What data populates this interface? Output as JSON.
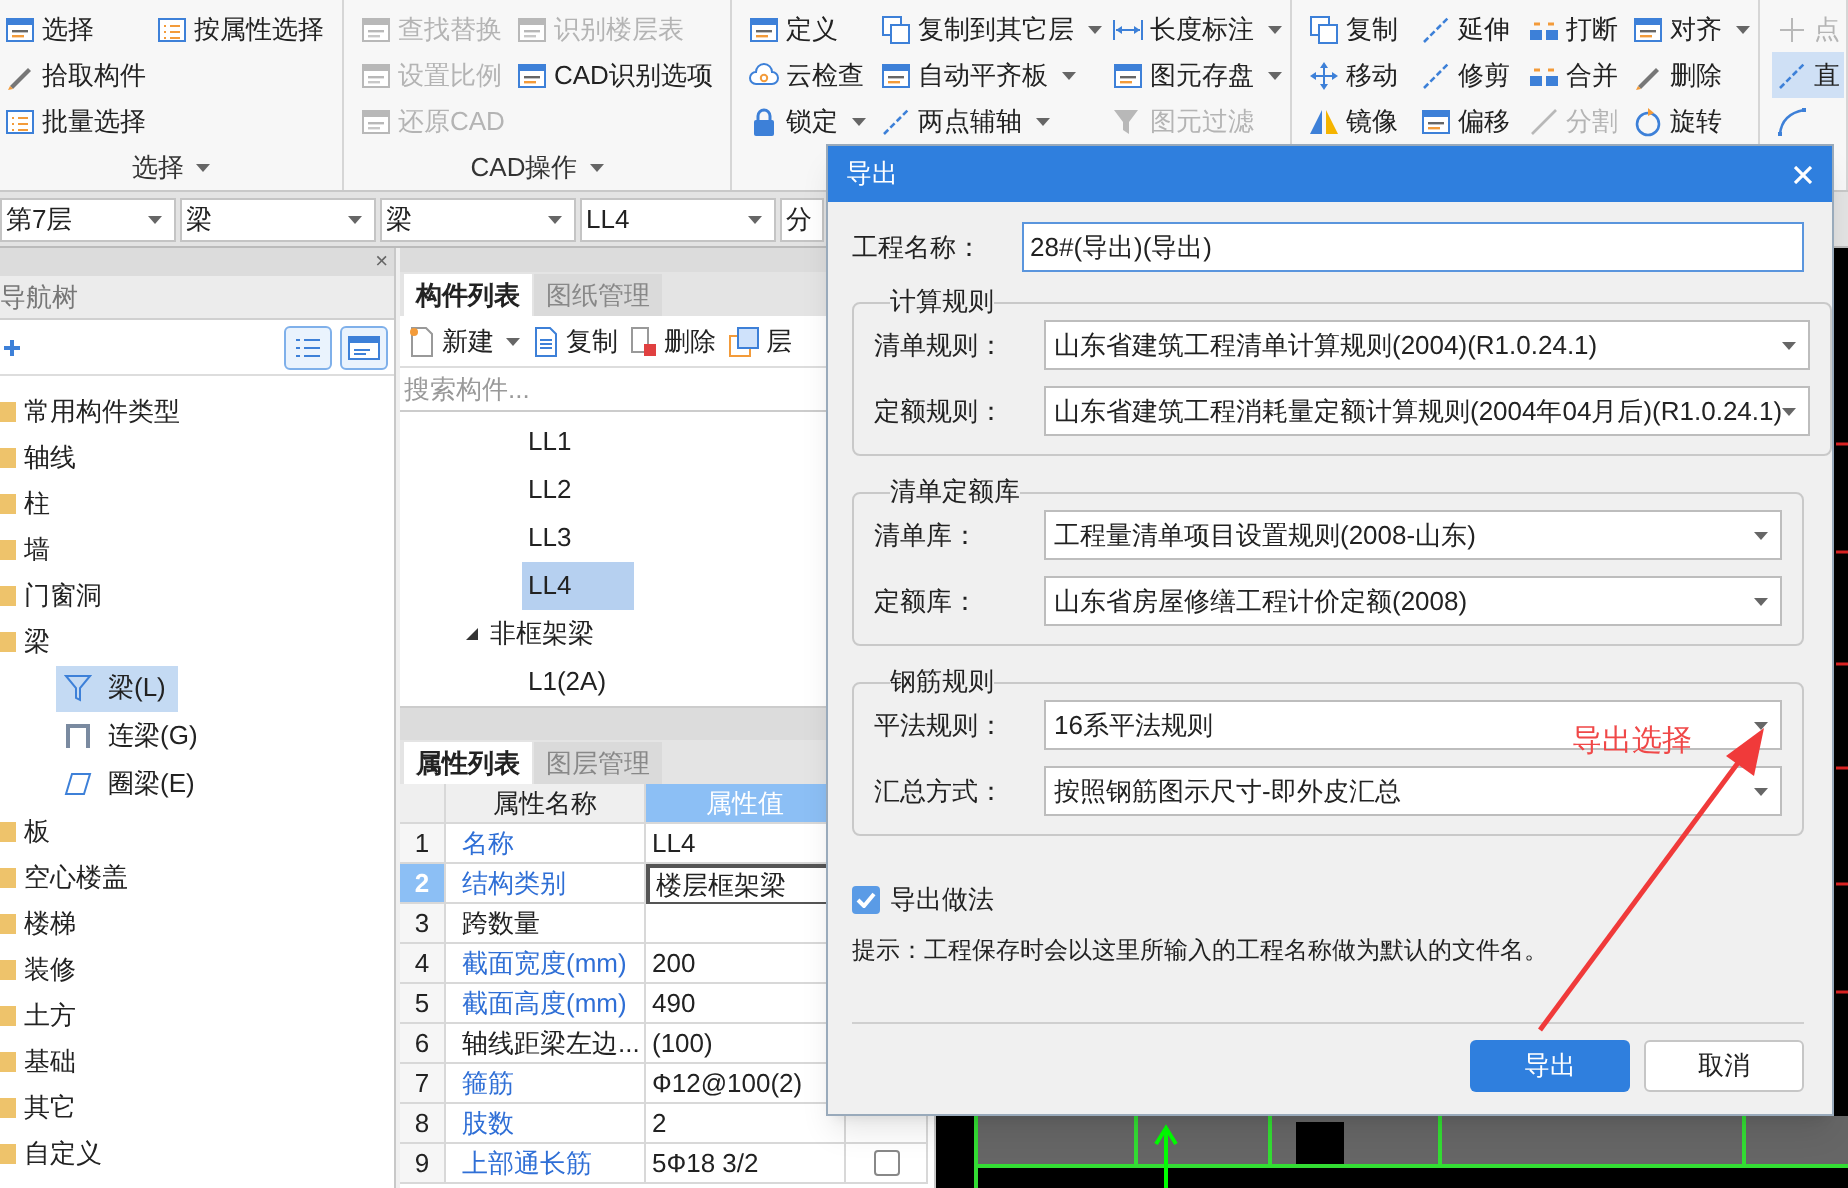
{
  "ribbon": {
    "groups": [
      {
        "label": "选择",
        "columns": [
          [
            {
              "label": "选择",
              "disabled": false,
              "dropdown": false,
              "selected": false
            },
            {
              "label": "拾取构件",
              "disabled": false,
              "dropdown": false,
              "selected": false
            },
            {
              "label": "批量选择",
              "disabled": false,
              "dropdown": false,
              "selected": false
            }
          ],
          [
            {
              "label": "按属性选择",
              "disabled": false,
              "dropdown": false,
              "selected": false
            }
          ]
        ]
      },
      {
        "label": "CAD操作",
        "columns": [
          [
            {
              "label": "查找替换",
              "disabled": true,
              "dropdown": false,
              "selected": false
            },
            {
              "label": "设置比例",
              "disabled": true,
              "dropdown": false,
              "selected": false
            },
            {
              "label": "还原CAD",
              "disabled": true,
              "dropdown": false,
              "selected": false
            }
          ],
          [
            {
              "label": "识别楼层表",
              "disabled": true,
              "dropdown": false,
              "selected": false
            },
            {
              "label": "CAD识别选项",
              "disabled": false,
              "dropdown": false,
              "selected": false
            }
          ]
        ]
      },
      {
        "columns": [
          [
            {
              "label": "定义",
              "disabled": false,
              "dropdown": false,
              "selected": false
            },
            {
              "label": "云检查",
              "disabled": false,
              "dropdown": false,
              "selected": false
            },
            {
              "label": "锁定",
              "disabled": false,
              "dropdown": true,
              "selected": false
            }
          ],
          [
            {
              "label": "复制到其它层",
              "disabled": false,
              "dropdown": true,
              "selected": false
            },
            {
              "label": "自动平齐板",
              "disabled": false,
              "dropdown": true,
              "selected": false
            },
            {
              "label": "两点辅轴",
              "disabled": false,
              "dropdown": true,
              "selected": false
            }
          ],
          [
            {
              "label": "长度标注",
              "disabled": false,
              "dropdown": true,
              "selected": false
            },
            {
              "label": "图元存盘",
              "disabled": false,
              "dropdown": true,
              "selected": false
            },
            {
              "label": "图元过滤",
              "disabled": true,
              "dropdown": false,
              "selected": false
            }
          ]
        ]
      },
      {
        "columns": [
          [
            {
              "label": "复制",
              "disabled": false,
              "dropdown": false,
              "selected": false
            },
            {
              "label": "移动",
              "disabled": false,
              "dropdown": false,
              "selected": false
            },
            {
              "label": "镜像",
              "disabled": false,
              "dropdown": false,
              "selected": false
            }
          ],
          [
            {
              "label": "延伸",
              "disabled": false,
              "dropdown": false,
              "selected": false
            },
            {
              "label": "修剪",
              "disabled": false,
              "dropdown": false,
              "selected": false
            },
            {
              "label": "偏移",
              "disabled": false,
              "dropdown": false,
              "selected": false
            }
          ],
          [
            {
              "label": "打断",
              "disabled": false,
              "dropdown": false,
              "selected": false
            },
            {
              "label": "合并",
              "disabled": false,
              "dropdown": false,
              "selected": false
            },
            {
              "label": "分割",
              "disabled": true,
              "dropdown": false,
              "selected": false
            }
          ],
          [
            {
              "label": "对齐",
              "disabled": false,
              "dropdown": true,
              "selected": false
            },
            {
              "label": "删除",
              "disabled": false,
              "dropdown": false,
              "selected": false
            },
            {
              "label": "旋转",
              "disabled": false,
              "dropdown": false,
              "selected": false
            }
          ]
        ]
      },
      {
        "columns": [
          [
            {
              "label": "点",
              "disabled": true,
              "dropdown": false,
              "selected": false
            },
            {
              "label": "直",
              "disabled": false,
              "dropdown": false,
              "selected": true
            },
            {
              "disabled": false,
              "dropdown": false,
              "selected": false
            }
          ]
        ]
      }
    ]
  },
  "selectors": [
    {
      "value": "第7层"
    },
    {
      "value": "梁"
    },
    {
      "value": "梁"
    },
    {
      "value": "LL4"
    },
    {
      "value": "分"
    }
  ],
  "nav_tree": {
    "close": "×",
    "title": "导航树",
    "items": [
      {
        "label": "常用构件类型",
        "selected": false
      },
      {
        "label": "轴线",
        "selected": false
      },
      {
        "label": "柱",
        "selected": false
      },
      {
        "label": "墙",
        "selected": false
      },
      {
        "label": "门窗洞",
        "selected": false
      },
      {
        "label": "梁",
        "selected": false,
        "children": [
          {
            "label": "梁(L)",
            "selected": true
          },
          {
            "label": "连梁(G)",
            "selected": false
          },
          {
            "label": "圈梁(E)",
            "selected": false
          }
        ]
      },
      {
        "label": "板",
        "selected": false
      },
      {
        "label": "空心楼盖",
        "selected": false
      },
      {
        "label": "楼梯",
        "selected": false
      },
      {
        "label": "装修",
        "selected": false
      },
      {
        "label": "土方",
        "selected": false
      },
      {
        "label": "基础",
        "selected": false
      },
      {
        "label": "其它",
        "selected": false
      },
      {
        "label": "自定义",
        "selected": false
      }
    ]
  },
  "component_list": {
    "tabs": [
      {
        "label": "构件列表",
        "selected": true
      },
      {
        "label": "图纸管理",
        "selected": false
      }
    ],
    "toolbar": [
      {
        "label": "新建",
        "dropdown": true
      },
      {
        "label": "复制",
        "dropdown": false
      },
      {
        "label": "删除",
        "dropdown": false
      },
      {
        "label": "层",
        "dropdown": false
      }
    ],
    "search": {
      "placeholder": "搜索构件..."
    },
    "items": [
      {
        "label": "LL1",
        "selected": false
      },
      {
        "label": "LL2",
        "selected": false
      },
      {
        "label": "LL3",
        "selected": false
      },
      {
        "label": "LL4",
        "selected": true
      },
      {
        "label": "非框架梁",
        "selected": false,
        "expanded": true,
        "children": [
          {
            "label": "L1(2A)",
            "selected": false
          }
        ]
      }
    ]
  },
  "properties": {
    "tabs": [
      {
        "label": "属性列表",
        "selected": true
      },
      {
        "label": "图层管理",
        "selected": false
      }
    ],
    "columns": [
      "属性名称",
      "属性值"
    ],
    "rows": [
      {
        "num": "1",
        "name": "名称",
        "value": "LL4",
        "public": true,
        "selected": false
      },
      {
        "num": "2",
        "name": "结构类别",
        "value": "楼层框架梁",
        "public": true,
        "selected": true
      },
      {
        "num": "3",
        "name": "跨数量",
        "public": false,
        "selected": false
      },
      {
        "num": "4",
        "name": "截面宽度(mm)",
        "value": "200",
        "public": true,
        "selected": false
      },
      {
        "num": "5",
        "name": "截面高度(mm)",
        "value": "490",
        "public": true,
        "selected": false
      },
      {
        "num": "6",
        "name": "轴线距梁左边...",
        "value": "(100)",
        "public": false,
        "selected": false
      },
      {
        "num": "7",
        "name": "箍筋",
        "value": "Ф12@100(2)",
        "public": true,
        "selected": false
      },
      {
        "num": "8",
        "name": "肢数",
        "value": "2",
        "public": true,
        "selected": false
      },
      {
        "num": "9",
        "name": "上部通长筋",
        "value": "5Ф18 3/2",
        "public": true,
        "selected": false,
        "checked": false
      }
    ]
  },
  "dialog": {
    "title": "导出",
    "project_name": {
      "label": "工程名称：",
      "value": "28#(导出)(导出)"
    },
    "groups": [
      {
        "title": "计算规则",
        "fields": [
          {
            "label": "清单规则：",
            "value": "山东省建筑工程清单计算规则(2004)(R1.0.24.1)"
          },
          {
            "label": "定额规则：",
            "value": "山东省建筑工程消耗量定额计算规则(2004年04月后)(R1.0.24.1)"
          }
        ]
      },
      {
        "title": "清单定额库",
        "fields": [
          {
            "label": "清单库：",
            "value": "工程量清单项目设置规则(2008-山东)"
          },
          {
            "label": "定额库：",
            "value": "山东省房屋修缮工程计价定额(2008)"
          }
        ]
      },
      {
        "title": "钢筋规则",
        "fields": [
          {
            "label": "平法规则：",
            "value": "16系平法规则"
          },
          {
            "label": "汇总方式：",
            "value": "按照钢筋图示尺寸-即外皮汇总"
          }
        ]
      }
    ],
    "export_method": {
      "label": "导出做法",
      "checked": true
    },
    "hint": "提示：工程保存时会以这里所输入的工程名称做为默认的文件名。",
    "buttons": [
      {
        "label": "导出",
        "primary": true
      },
      {
        "label": "取消",
        "primary": false
      }
    ]
  },
  "annotation": {
    "text": "导出选择"
  }
}
